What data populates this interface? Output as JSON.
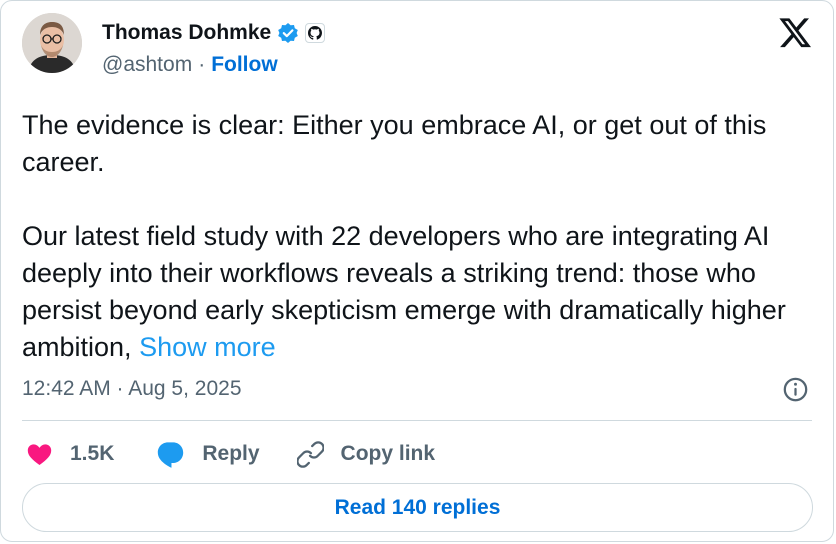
{
  "author": {
    "name": "Thomas Dohmke",
    "handle": "@ashtom",
    "separator": "·",
    "follow_label": "Follow"
  },
  "icons": {
    "verified": "verified-badge-icon",
    "github": "github-icon",
    "x_logo": "x-logo-icon",
    "info": "info-icon",
    "like": "heart-icon",
    "reply": "speech-bubble-icon",
    "copy": "link-icon"
  },
  "tweet": {
    "paragraph_1": "The evidence is clear: Either you embrace AI, or get out of this career.",
    "paragraph_2": "Our latest field study with 22 developers who are integrating AI deeply into their workflows reveals a striking trend: those who persist beyond early skepticism emerge with dramatically higher ambition, ",
    "show_more": "Show more",
    "timestamp": "12:42 AM · Aug 5, 2025"
  },
  "actions": {
    "like_count": "1.5K",
    "reply_label": "Reply",
    "copy_label": "Copy link"
  },
  "read_replies_label": "Read 140 replies",
  "colors": {
    "accent": "#1d9bf0",
    "link_bold": "#006fd6",
    "like": "#f91880",
    "text": "#0f1419",
    "muted": "#536471",
    "border": "#cfd9de"
  }
}
